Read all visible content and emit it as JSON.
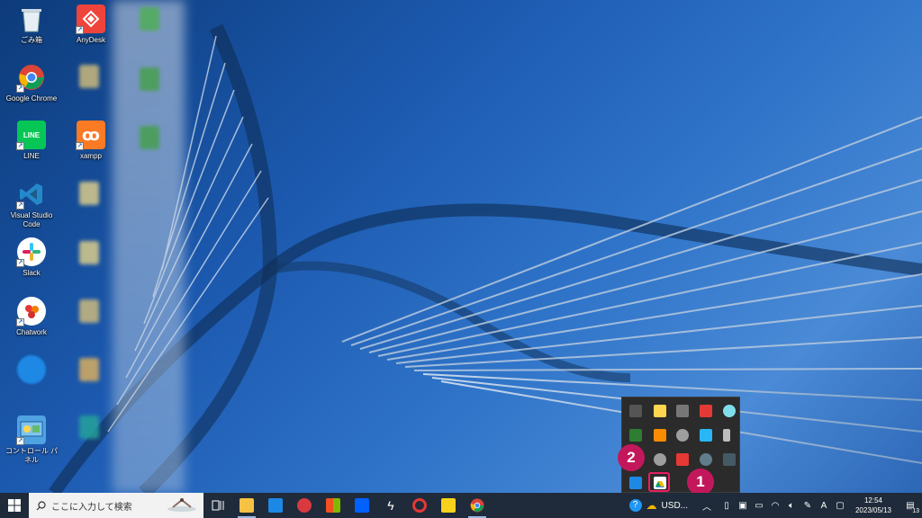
{
  "desktop": {
    "icons": [
      {
        "label": "ごみ箱"
      },
      {
        "label": "AnyDesk"
      },
      {
        "label": "Google Chrome"
      },
      {
        "label": "LINE"
      },
      {
        "label": "xampp"
      },
      {
        "label": "Visual Studio Code"
      },
      {
        "label": "Slack"
      },
      {
        "label": "Chatwork"
      },
      {
        "label": "コントロール パネル"
      }
    ]
  },
  "taskbar": {
    "search_placeholder": "ここに入力して検索",
    "currency_label": "USD...",
    "ime_label": "A",
    "clock_time": "12:54",
    "clock_date": "2023/05/13",
    "notification_count": "13"
  },
  "annotations": {
    "badge_1": "1",
    "badge_2": "2"
  },
  "colors": {
    "highlight": "#e91e63",
    "badge": "#c2185b",
    "taskbar": "#1f2b3a",
    "tray_popup": "#2b2b2b"
  }
}
